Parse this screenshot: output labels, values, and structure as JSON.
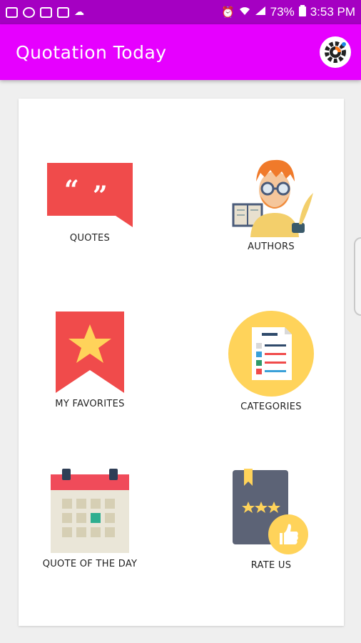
{
  "status_bar": {
    "battery": "73%",
    "time": "3:53 PM"
  },
  "app_bar": {
    "title": "Quotation Today",
    "settings_icon": "gear-icon"
  },
  "menu": [
    {
      "label": "QUOTES",
      "icon": "quote-bubble-icon"
    },
    {
      "label": "AUTHORS",
      "icon": "author-icon"
    },
    {
      "label": "MY FAVORITES",
      "icon": "star-bookmark-icon"
    },
    {
      "label": "CATEGORIES",
      "icon": "categories-list-icon"
    },
    {
      "label": "QUOTE OF THE DAY",
      "icon": "calendar-icon"
    },
    {
      "label": "RATE US",
      "icon": "rating-book-icon"
    }
  ],
  "colors": {
    "status_bar": "#a500c2",
    "app_bar": "#e600ff",
    "accent_red": "#f04b4b",
    "accent_yellow": "#ffd35a"
  }
}
